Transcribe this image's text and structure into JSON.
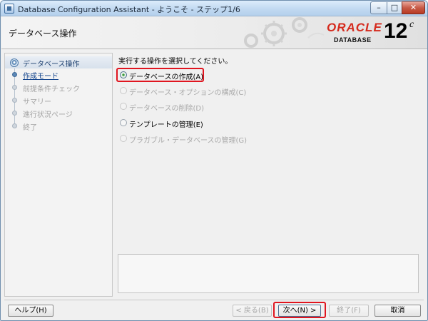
{
  "window": {
    "title": "Database Configuration Assistant - ようこそ - ステップ1/6",
    "controls": {
      "minimize": "–",
      "maximize": "□",
      "close": "✕"
    }
  },
  "header": {
    "page_title": "データベース操作",
    "logo_brand": "ORACLE",
    "logo_product": "DATABASE",
    "logo_version": "12",
    "logo_suffix": "c"
  },
  "nav": {
    "items": [
      {
        "label": "データベース操作",
        "state": "current"
      },
      {
        "label": "作成モード",
        "state": "link"
      },
      {
        "label": "前提条件チェック",
        "state": "disabled"
      },
      {
        "label": "サマリー",
        "state": "disabled"
      },
      {
        "label": "進行状況ページ",
        "state": "disabled"
      },
      {
        "label": "終了",
        "state": "disabled"
      }
    ]
  },
  "main": {
    "instruction": "実行する操作を選択してください。",
    "options": [
      {
        "label": "データベースの作成(A)",
        "selected": true,
        "enabled": true
      },
      {
        "label": "データベース・オプションの構成(C)",
        "selected": false,
        "enabled": false
      },
      {
        "label": "データベースの削除(D)",
        "selected": false,
        "enabled": false
      },
      {
        "label": "テンプレートの管理(E)",
        "selected": false,
        "enabled": true
      },
      {
        "label": "プラガブル・データベースの管理(G)",
        "selected": false,
        "enabled": false
      }
    ]
  },
  "buttons": {
    "help": "ヘルプ(H)",
    "back": "< 戻る(B)",
    "next": "次へ(N) >",
    "finish": "終了(F)",
    "cancel": "取消"
  },
  "colors": {
    "highlight": "#e0151f",
    "oracle_red": "#d52b1e",
    "link": "#0c3f8a"
  }
}
